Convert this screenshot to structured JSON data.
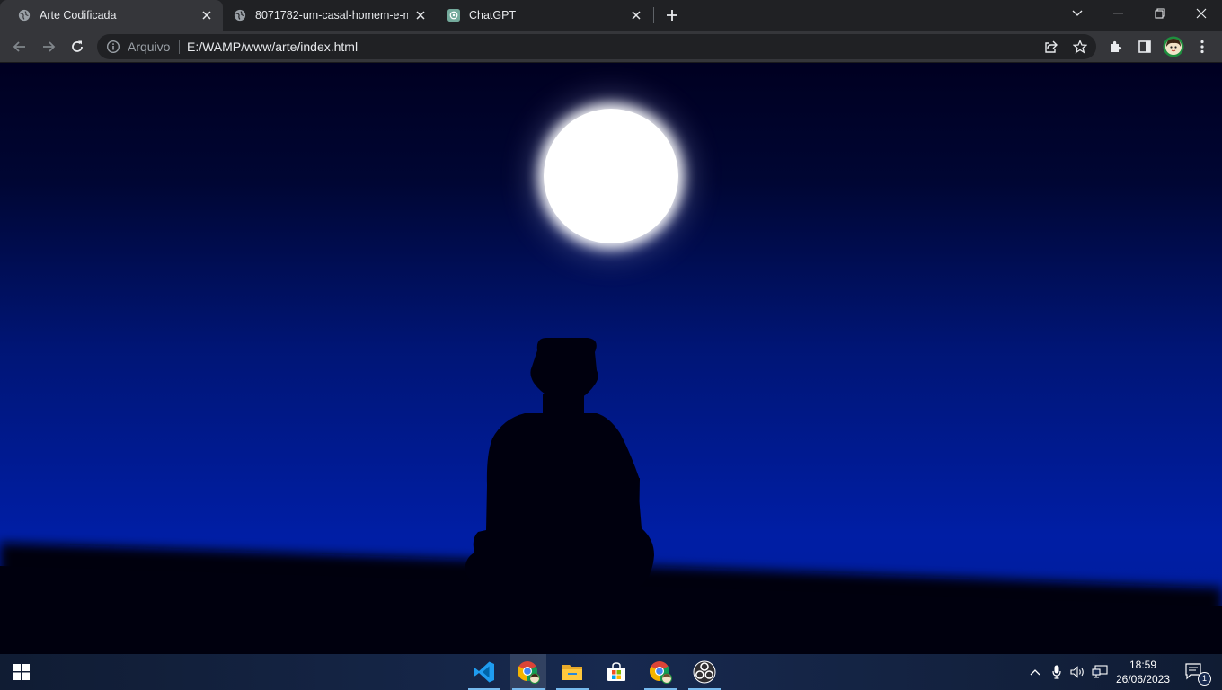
{
  "browser": {
    "tabs": [
      {
        "title": "Arte Codificada",
        "active": true,
        "icon": "globe-icon"
      },
      {
        "title": "8071782-um-casal-homem-e-mu",
        "active": false,
        "icon": "globe-icon"
      },
      {
        "title": "ChatGPT",
        "active": false,
        "icon": "chatgpt-icon"
      }
    ],
    "address": {
      "scheme_label": "Arquivo",
      "url": "E:/WAMP/www/arte/index.html"
    }
  },
  "taskbar": {
    "apps": [
      {
        "name": "vscode-icon",
        "open": true
      },
      {
        "name": "chrome-profile-icon",
        "open": true,
        "active": true
      },
      {
        "name": "file-explorer-icon",
        "open": true
      },
      {
        "name": "microsoft-store-icon",
        "open": false
      },
      {
        "name": "chrome-icon",
        "open": true
      },
      {
        "name": "obs-icon",
        "open": true
      }
    ],
    "clock": {
      "time": "18:59",
      "date": "26/06/2023"
    },
    "notification_count": "1"
  },
  "colors": {
    "tabstrip": "#202124",
    "toolbar": "#35363a",
    "sky_top": "#000021",
    "sky_bottom": "#001ea5",
    "moon": "#ffffff",
    "silhouette": "#00000e"
  }
}
